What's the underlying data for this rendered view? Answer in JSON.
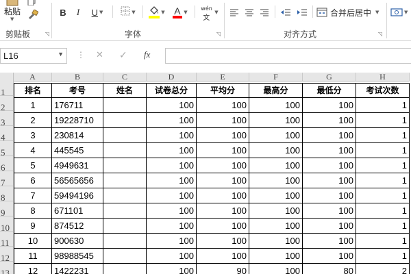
{
  "ribbon": {
    "paste_label": "粘贴",
    "groups": {
      "clipboard": "剪贴板",
      "font": "字体",
      "alignment": "对齐方式"
    },
    "bold": "B",
    "italic": "I",
    "underline": "U",
    "font_color_letter": "A",
    "phonetic_label": "wén",
    "merge_center": "合并后居中",
    "colors": {
      "highlight": "#ffff00",
      "font_color": "#ff0000"
    }
  },
  "formula_bar": {
    "name_box": "L16",
    "cancel": "✕",
    "enter": "✓",
    "fx": "fx",
    "formula": ""
  },
  "sheet": {
    "columns": [
      "A",
      "B",
      "C",
      "D",
      "E",
      "F",
      "G",
      "H"
    ],
    "row_numbers": [
      "1",
      "2",
      "3",
      "4",
      "5",
      "6",
      "7",
      "8",
      "9",
      "10",
      "11",
      "12",
      "13"
    ],
    "header": [
      "排名",
      "考号",
      "姓名",
      "试卷总分",
      "平均分",
      "最高分",
      "最低分",
      "考试次数"
    ],
    "rows": [
      [
        "1",
        "176711",
        "",
        "100",
        "100",
        "100",
        "100",
        "1"
      ],
      [
        "2",
        "19228710",
        "",
        "100",
        "100",
        "100",
        "100",
        "1"
      ],
      [
        "3",
        "230814",
        "",
        "100",
        "100",
        "100",
        "100",
        "1"
      ],
      [
        "4",
        "445545",
        "",
        "100",
        "100",
        "100",
        "100",
        "1"
      ],
      [
        "5",
        "4949631",
        "",
        "100",
        "100",
        "100",
        "100",
        "1"
      ],
      [
        "6",
        "56565656",
        "",
        "100",
        "100",
        "100",
        "100",
        "1"
      ],
      [
        "7",
        "59494196",
        "",
        "100",
        "100",
        "100",
        "100",
        "1"
      ],
      [
        "8",
        "671101",
        "",
        "100",
        "100",
        "100",
        "100",
        "1"
      ],
      [
        "9",
        "874512",
        "",
        "100",
        "100",
        "100",
        "100",
        "1"
      ],
      [
        "10",
        "900630",
        "",
        "100",
        "100",
        "100",
        "100",
        "1"
      ],
      [
        "11",
        "98988545",
        "",
        "100",
        "100",
        "100",
        "100",
        "1"
      ],
      [
        "12",
        "1422231",
        "",
        "100",
        "90",
        "100",
        "80",
        "2"
      ]
    ]
  }
}
